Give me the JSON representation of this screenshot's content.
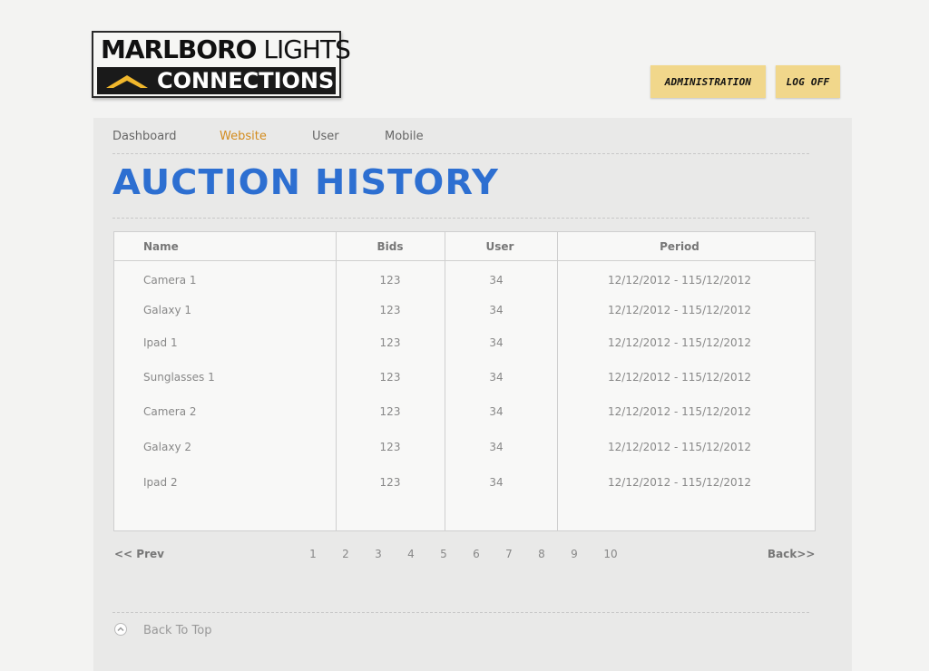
{
  "logo": {
    "line1_bold": "MARLBORO",
    "line1_rest": "LIGHTS",
    "line2": "CONNECTIONS"
  },
  "header_buttons": {
    "administration": "ADMINISTRATION",
    "log_off": "LOG OFF"
  },
  "nav": {
    "items": [
      {
        "label": "Dashboard",
        "active": false
      },
      {
        "label": "Website",
        "active": true
      },
      {
        "label": "User",
        "active": false
      },
      {
        "label": "Mobile",
        "active": false
      }
    ]
  },
  "page_title": "AUCTION HISTORY",
  "table": {
    "headers": [
      "Name",
      "Bids",
      "User",
      "Period"
    ],
    "rows": [
      {
        "name": "Camera 1",
        "bids": "123",
        "user": "34",
        "period": "12/12/2012 - 115/12/2012"
      },
      {
        "name": "Galaxy 1",
        "bids": "123",
        "user": "34",
        "period": "12/12/2012 - 115/12/2012"
      },
      {
        "name": "Ipad 1",
        "bids": "123",
        "user": "34",
        "period": "12/12/2012 - 115/12/2012"
      },
      {
        "name": "Sunglasses 1",
        "bids": "123",
        "user": "34",
        "period": "12/12/2012 - 115/12/2012"
      },
      {
        "name": "Camera 2",
        "bids": "123",
        "user": "34",
        "period": "12/12/2012 - 115/12/2012"
      },
      {
        "name": "Galaxy 2",
        "bids": "123",
        "user": "34",
        "period": "12/12/2012 - 115/12/2012"
      },
      {
        "name": "Ipad 2",
        "bids": "123",
        "user": "34",
        "period": "12/12/2012 - 115/12/2012"
      }
    ]
  },
  "pagination": {
    "prev": "<< Prev",
    "pages": [
      "1",
      "2",
      "3",
      "4",
      "5",
      "6",
      "7",
      "8",
      "9",
      "10"
    ],
    "next": "Back>>"
  },
  "back_to_top": "Back To Top",
  "colors": {
    "accent_nav": "#d38c1e",
    "title": "#2d6fd1",
    "button_bg": "#f1d78b"
  }
}
